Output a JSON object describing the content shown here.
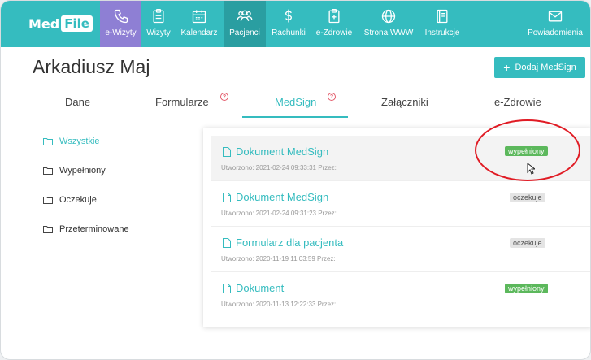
{
  "logo": {
    "part1": "Med",
    "part2": "File"
  },
  "nav": {
    "items": [
      {
        "label": "e-Wizyty",
        "icon": "phone-icon"
      },
      {
        "label": "Wizyty",
        "icon": "clipboard-icon"
      },
      {
        "label": "Kalendarz",
        "icon": "calendar-icon"
      },
      {
        "label": "Pacjenci",
        "icon": "users-icon"
      },
      {
        "label": "Rachunki",
        "icon": "dollar-icon"
      },
      {
        "label": "e-Zdrowie",
        "icon": "medical-document-icon"
      },
      {
        "label": "Strona WWW",
        "icon": "globe-icon"
      },
      {
        "label": "Instrukcje",
        "icon": "book-icon"
      },
      {
        "label": "Powiadomienia",
        "icon": "mail-icon"
      }
    ]
  },
  "page": {
    "title": "Arkadiusz Maj"
  },
  "toolbar": {
    "add_label": "Dodaj MedSign",
    "add_symbol": "+"
  },
  "tabs": [
    {
      "label": "Dane"
    },
    {
      "label": "Formularze",
      "help": "?"
    },
    {
      "label": "MedSign",
      "help": "?"
    },
    {
      "label": "Załączniki"
    },
    {
      "label": "e-Zdrowie"
    }
  ],
  "sidebar": {
    "items": [
      {
        "label": "Wszystkie"
      },
      {
        "label": "Wypełniony"
      },
      {
        "label": "Oczekuje"
      },
      {
        "label": "Przeterminowane"
      }
    ]
  },
  "documents": [
    {
      "title": "Dokument MedSign",
      "meta": "Utworzono: 2021-02-24 09:33:31  Przez:",
      "status": "wypełniony"
    },
    {
      "title": "Dokument MedSign",
      "meta": "Utworzono: 2021-02-24 09:31:23  Przez:",
      "status": "oczekuje"
    },
    {
      "title": "Formularz dla pacjenta",
      "meta": "Utworzono: 2020-11-19 11:03:59  Przez:",
      "status": "oczekuje"
    },
    {
      "title": "Dokument",
      "meta": "Utworzono: 2020-11-13 12:22:33  Przez:",
      "status": "wypełniony"
    }
  ],
  "colors": {
    "accent": "#35bcbf",
    "active_nav": "#8e7fd4",
    "success": "#5cb85c",
    "annotation": "#e01b24"
  }
}
